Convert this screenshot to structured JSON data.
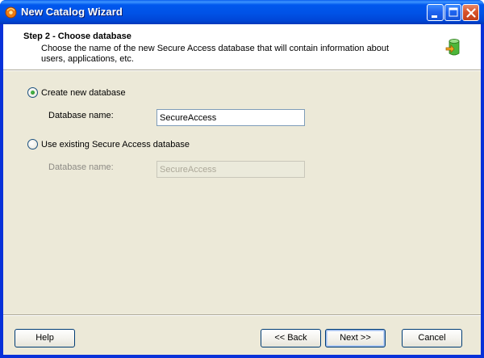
{
  "window": {
    "title": "New Catalog Wizard",
    "controls": [
      "minimize",
      "maximize",
      "close"
    ]
  },
  "header": {
    "step_title": "Step 2 - Choose database",
    "description": "Choose the name of the new Secure Access database that will contain information about users, applications, etc.",
    "icon": "database-arrow-icon"
  },
  "options": {
    "create_new": {
      "label": "Create new database",
      "selected": true,
      "field_label": "Database name:",
      "field_value": "SecureAccess",
      "enabled": true
    },
    "use_existing": {
      "label": "Use existing Secure Access database",
      "selected": false,
      "field_label": "Database name:",
      "field_value": "SecureAccess",
      "enabled": false
    }
  },
  "buttons": {
    "help": "Help",
    "back": "<< Back",
    "next": "Next >>",
    "cancel": "Cancel"
  },
  "colors": {
    "titlebar": "#0058ee",
    "dialog_bg": "#ece9d8",
    "selected_radio": "#21a121"
  }
}
